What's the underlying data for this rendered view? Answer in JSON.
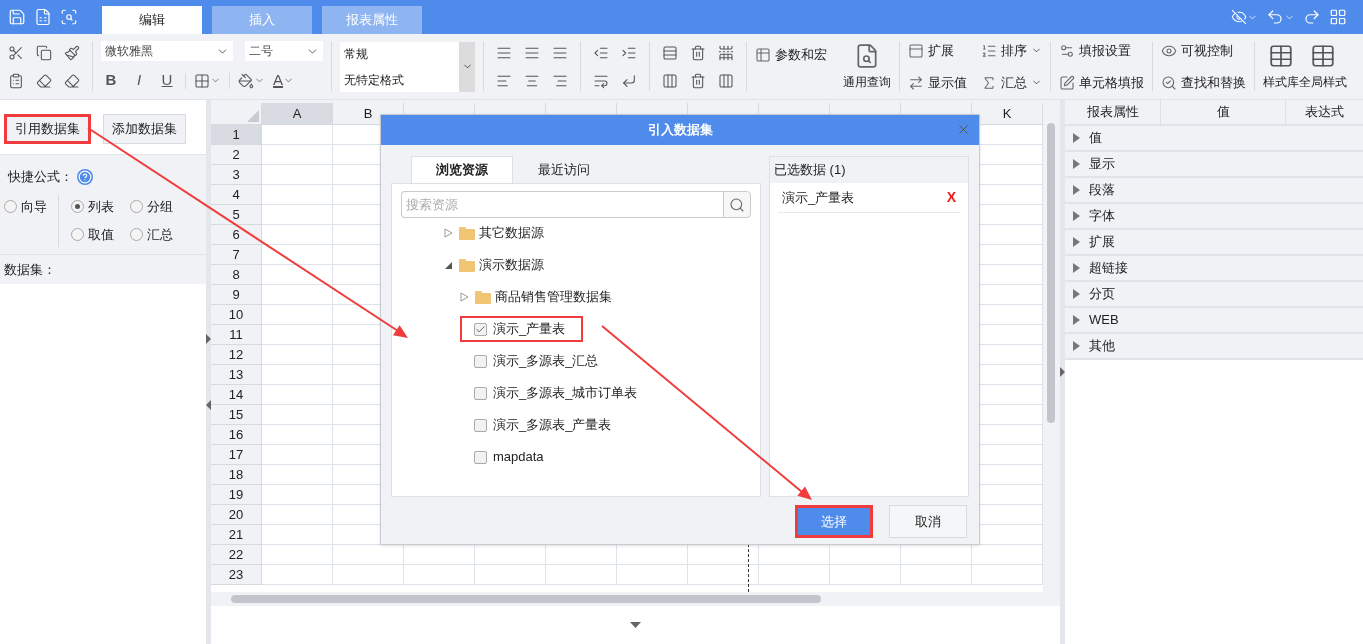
{
  "header": {
    "tabs": [
      {
        "label": "编辑",
        "selected": true
      },
      {
        "label": "插入",
        "selected": false
      },
      {
        "label": "报表属性",
        "selected": false
      }
    ]
  },
  "ribbon": {
    "font": "微软雅黑",
    "font_size": "二号",
    "text_styles": [
      "B",
      "I",
      "U"
    ],
    "font_color_glyph": "A",
    "format_lines": [
      "常规",
      "无特定格式"
    ],
    "commands": [
      "参数和宏",
      "通用查询",
      "扩展",
      "显示值",
      "排序",
      "汇总",
      "填报设置",
      "单元格填报",
      "可视控制",
      "查找和替换",
      "样式库",
      "全局样式"
    ]
  },
  "left_panel": {
    "buttons": [
      {
        "label": "引用数据集",
        "highlighted": true
      },
      {
        "label": "添加数据集",
        "highlighted": false
      }
    ],
    "quick_formula_label": "快捷公式：",
    "radios": [
      {
        "label": "向导",
        "selected": false
      },
      {
        "label": "列表",
        "selected": true
      },
      {
        "label": "分组",
        "selected": false
      },
      {
        "label": "取值",
        "selected": false
      },
      {
        "label": "汇总",
        "selected": false
      }
    ],
    "dataset_label": "数据集："
  },
  "grid": {
    "columns": [
      {
        "label": "A",
        "selected": true
      },
      {
        "label": "B",
        "selected": false
      },
      {
        "selected": false
      },
      {
        "selected": false
      },
      {
        "selected": false
      },
      {
        "selected": false
      },
      {
        "selected": false
      },
      {
        "selected": false
      },
      {
        "selected": false
      },
      {
        "selected": false
      },
      {
        "label": "K",
        "selected": false
      }
    ],
    "rows": [
      {
        "label": "1",
        "selected": true
      },
      {
        "label": "2",
        "selected": false
      },
      {
        "label": "3",
        "selected": false
      },
      {
        "label": "4",
        "selected": false
      },
      {
        "label": "5",
        "selected": false
      },
      {
        "label": "6",
        "selected": false
      },
      {
        "label": "7",
        "selected": false
      },
      {
        "label": "8",
        "selected": false
      },
      {
        "label": "9",
        "selected": false
      },
      {
        "label": "10",
        "selected": false
      },
      {
        "label": "11",
        "selected": false
      },
      {
        "label": "12",
        "selected": false
      },
      {
        "label": "13",
        "selected": false
      },
      {
        "label": "14",
        "selected": false
      },
      {
        "label": "15",
        "selected": false
      },
      {
        "label": "16",
        "selected": false
      },
      {
        "label": "17",
        "selected": false
      },
      {
        "label": "18",
        "selected": false
      },
      {
        "label": "19",
        "selected": false
      },
      {
        "label": "20",
        "selected": false
      },
      {
        "label": "21",
        "selected": false
      },
      {
        "label": "22",
        "selected": false
      },
      {
        "label": "23",
        "selected": false
      }
    ]
  },
  "properties": {
    "columns": [
      "报表属性",
      "值",
      "表达式"
    ],
    "groups": [
      {
        "label": "值",
        "expanded": false
      },
      {
        "label": "显示",
        "expanded": false
      },
      {
        "label": "段落",
        "expanded": false
      },
      {
        "label": "字体",
        "expanded": false
      },
      {
        "label": "扩展",
        "expanded": false
      },
      {
        "label": "超链接",
        "expanded": false
      },
      {
        "label": "分页",
        "expanded": false
      },
      {
        "label": "WEB",
        "expanded": false
      },
      {
        "label": "其他",
        "expanded": false
      }
    ]
  },
  "dialog": {
    "title": "引入数据集",
    "tabs": [
      {
        "label": "浏览资源",
        "selected": true
      },
      {
        "label": "最近访问",
        "selected": false
      }
    ],
    "search": {
      "placeholder": "搜索资源"
    },
    "tree": [
      {
        "kind": "folder",
        "label": "其它数据源",
        "expanded": false
      },
      {
        "kind": "folder",
        "label": "演示数据源",
        "expanded": true,
        "children": [
          {
            "kind": "folder",
            "label": "商品销售管理数据集",
            "expanded": false
          },
          {
            "kind": "dataset",
            "label": "演示_产量表",
            "checked": true,
            "highlighted": true
          },
          {
            "kind": "dataset",
            "label": "演示_多源表_汇总",
            "checked": false,
            "highlighted": false
          },
          {
            "kind": "dataset",
            "label": "演示_多源表_城市订单表",
            "checked": false,
            "highlighted": false
          },
          {
            "kind": "dataset",
            "label": "演示_多源表_产量表",
            "checked": false,
            "highlighted": false
          },
          {
            "kind": "dataset",
            "label": "mapdata",
            "checked": false,
            "highlighted": false
          }
        ]
      }
    ],
    "selected_panel": {
      "title": "已选数据 (1)",
      "items": [
        {
          "label": "演示_产量表",
          "remove": "X"
        }
      ]
    },
    "buttons": [
      {
        "label": "选择",
        "kind": "primary",
        "highlighted": true
      },
      {
        "label": "取消",
        "kind": "secondary",
        "highlighted": false
      }
    ]
  }
}
